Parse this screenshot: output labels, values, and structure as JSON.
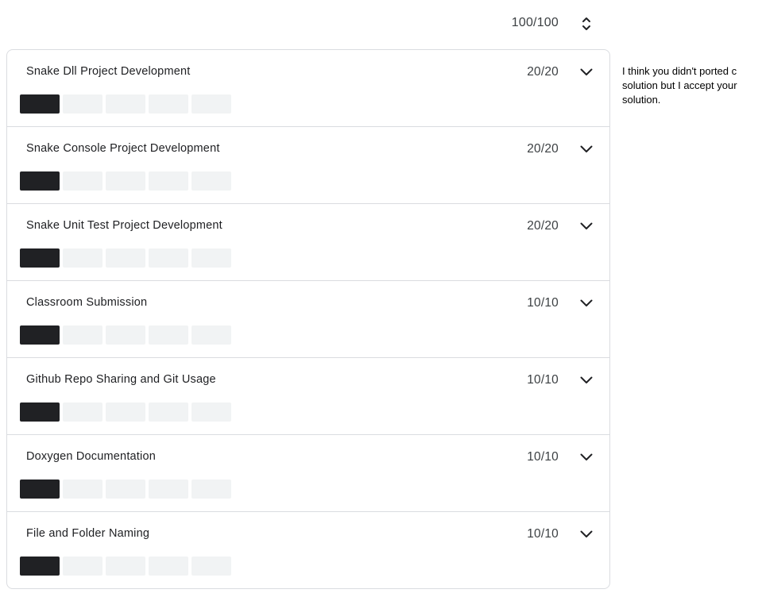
{
  "total": {
    "score": "100/100",
    "icon": "sort-unfold-icon"
  },
  "criteria": [
    {
      "title": "Snake Dll Project Development",
      "score": "20/20",
      "levels": 5,
      "selected": 0
    },
    {
      "title": "Snake Console Project Development",
      "score": "20/20",
      "levels": 5,
      "selected": 0
    },
    {
      "title": "Snake Unit Test Project Development",
      "score": "20/20",
      "levels": 5,
      "selected": 0
    },
    {
      "title": "Classroom Submission",
      "score": "10/10",
      "levels": 5,
      "selected": 0
    },
    {
      "title": "Github Repo Sharing and Git Usage",
      "score": "10/10",
      "levels": 5,
      "selected": 0
    },
    {
      "title": "Doxygen Documentation",
      "score": "10/10",
      "levels": 5,
      "selected": 0
    },
    {
      "title": "File and Folder Naming",
      "score": "10/10",
      "levels": 5,
      "selected": 0
    }
  ],
  "comment": "I think you didn't ported c\nsolution but I accept your\nsolution.",
  "colors": {
    "selected_level": "#202124",
    "unselected_level": "#f1f3f4",
    "border": "#dadce0"
  }
}
